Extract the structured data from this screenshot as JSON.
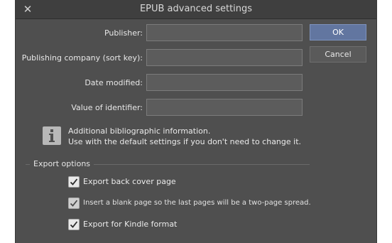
{
  "window": {
    "title": "EPUB advanced settings"
  },
  "fields": [
    {
      "label": "Publisher:",
      "value": ""
    },
    {
      "label": "Publishing company (sort key):",
      "value": ""
    },
    {
      "label": "Date modified:",
      "value": ""
    },
    {
      "label": "Value of identifier:",
      "value": ""
    }
  ],
  "buttons": {
    "ok": "OK",
    "cancel": "Cancel"
  },
  "info": {
    "icon": "info-icon",
    "line1": "Additional bibliographic information.",
    "line2": "Use with the default settings if you don't need to change it."
  },
  "export": {
    "title": "Export options",
    "options": [
      {
        "label": "Export back cover page",
        "checked": true
      },
      {
        "label": "Insert a blank page so the last pages will be a two-page spread.",
        "checked": true
      },
      {
        "label": "Export for Kindle format",
        "checked": true
      }
    ]
  },
  "colors": {
    "dialog_bg": "#4f4f4f",
    "primary_button": "#6276a0"
  }
}
